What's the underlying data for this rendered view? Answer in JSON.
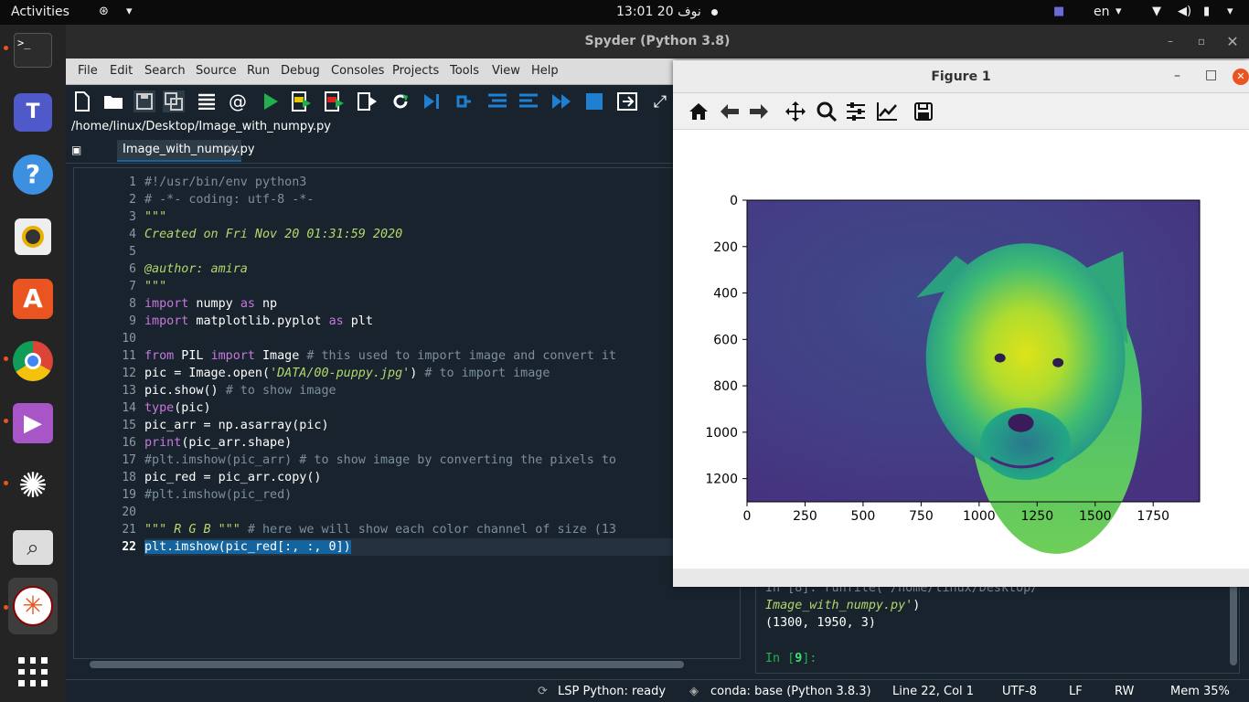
{
  "topbar": {
    "activities": "Activities",
    "clock": "13:01  نوف 20",
    "lang": "en"
  },
  "dock": {
    "items": [
      "terminal-icon",
      "teams-icon",
      "help-icon",
      "rhythmbox-icon",
      "software-icon",
      "chrome-icon",
      "media-icon",
      "spider-icon",
      "search-viewer-icon",
      "spyder-icon",
      "app-grid-icon"
    ]
  },
  "spyder": {
    "title": "Spyder (Python 3.8)",
    "menu": [
      "File",
      "Edit",
      "Search",
      "Source",
      "Run",
      "Debug",
      "Consoles",
      "Projects",
      "Tools",
      "View",
      "Help"
    ],
    "path": "/home/linux/Desktop/Image_with_numpy.py",
    "tab": "Image_with_numpy.py",
    "line_numbers": [
      "1",
      "2",
      "3",
      "4",
      "5",
      "6",
      "7",
      "8",
      "9",
      "10",
      "11",
      "12",
      "13",
      "14",
      "15",
      "16",
      "17",
      "18",
      "19",
      "20",
      "21",
      "22"
    ],
    "code": {
      "l1": "#!/usr/bin/env python3",
      "l2": "# -*- coding: utf-8 -*-",
      "l3": "\"\"\"",
      "l4": "Created on Fri Nov 20 01:31:59 2020",
      "l6": "@author: amira",
      "l7": "\"\"\"",
      "l8a": "import",
      "l8b": " numpy ",
      "l8c": "as",
      "l8d": " np",
      "l9a": "import",
      "l9b": " matplotlib.pyplot ",
      "l9c": "as",
      "l9d": " plt",
      "l11a": "from",
      "l11b": " PIL ",
      "l11c": "import",
      "l11d": " Image ",
      "l11e": "# this used to import image and convert it",
      "l12a": "pic = Image.open(",
      "l12b": "'DATA/00-puppy.jpg'",
      "l12c": ") ",
      "l12d": "# to import image",
      "l13a": "pic.show() ",
      "l13b": "# to show image",
      "l14a": "type",
      "l14b": "(pic)",
      "l15": "pic_arr = np.asarray(pic)",
      "l16a": "print",
      "l16b": "(pic_arr.shape)",
      "l17": "#plt.imshow(pic_arr) # to show image by converting the pixels to",
      "l18": "pic_red = pic_arr.copy()",
      "l19": "#plt.imshow(pic_red)",
      "l21a": "\"\"\" R G B \"\"\"",
      "l21b": " # here we will show each color channel of size (13",
      "l22": "plt.imshow(pic_red[:, :, 0])"
    },
    "console": {
      "partial": "In [8]: runfile('/home/linux/Desktop/",
      "file": "Image_with_numpy.py'",
      "close": ")",
      "output": "(1300, 1950, 3)",
      "prompt_a": "In [",
      "prompt_num": "9",
      "prompt_b": "]:"
    },
    "status": {
      "lsp": "LSP Python: ready",
      "conda": "conda: base (Python 3.8.3)",
      "pos": "Line 22, Col 1",
      "enc": "UTF-8",
      "eol": "LF",
      "rw": "RW",
      "mem": "Mem 35%"
    }
  },
  "figure": {
    "title": "Figure 1",
    "tools": [
      "home-icon",
      "back-icon",
      "forward-icon",
      "pan-icon",
      "zoom-icon",
      "configure-icon",
      "edit-curves-icon",
      "save-icon"
    ]
  },
  "chart_data": {
    "type": "heatmap",
    "xticks": [
      "0",
      "250",
      "500",
      "750",
      "1000",
      "1250",
      "1500",
      "1750"
    ],
    "yticks": [
      "0",
      "200",
      "400",
      "600",
      "800",
      "1000",
      "1200"
    ],
    "xlim": [
      0,
      1950
    ],
    "ylim": [
      1300,
      0
    ],
    "image_shape": [
      1300,
      1950
    ],
    "colormap": "viridis"
  }
}
